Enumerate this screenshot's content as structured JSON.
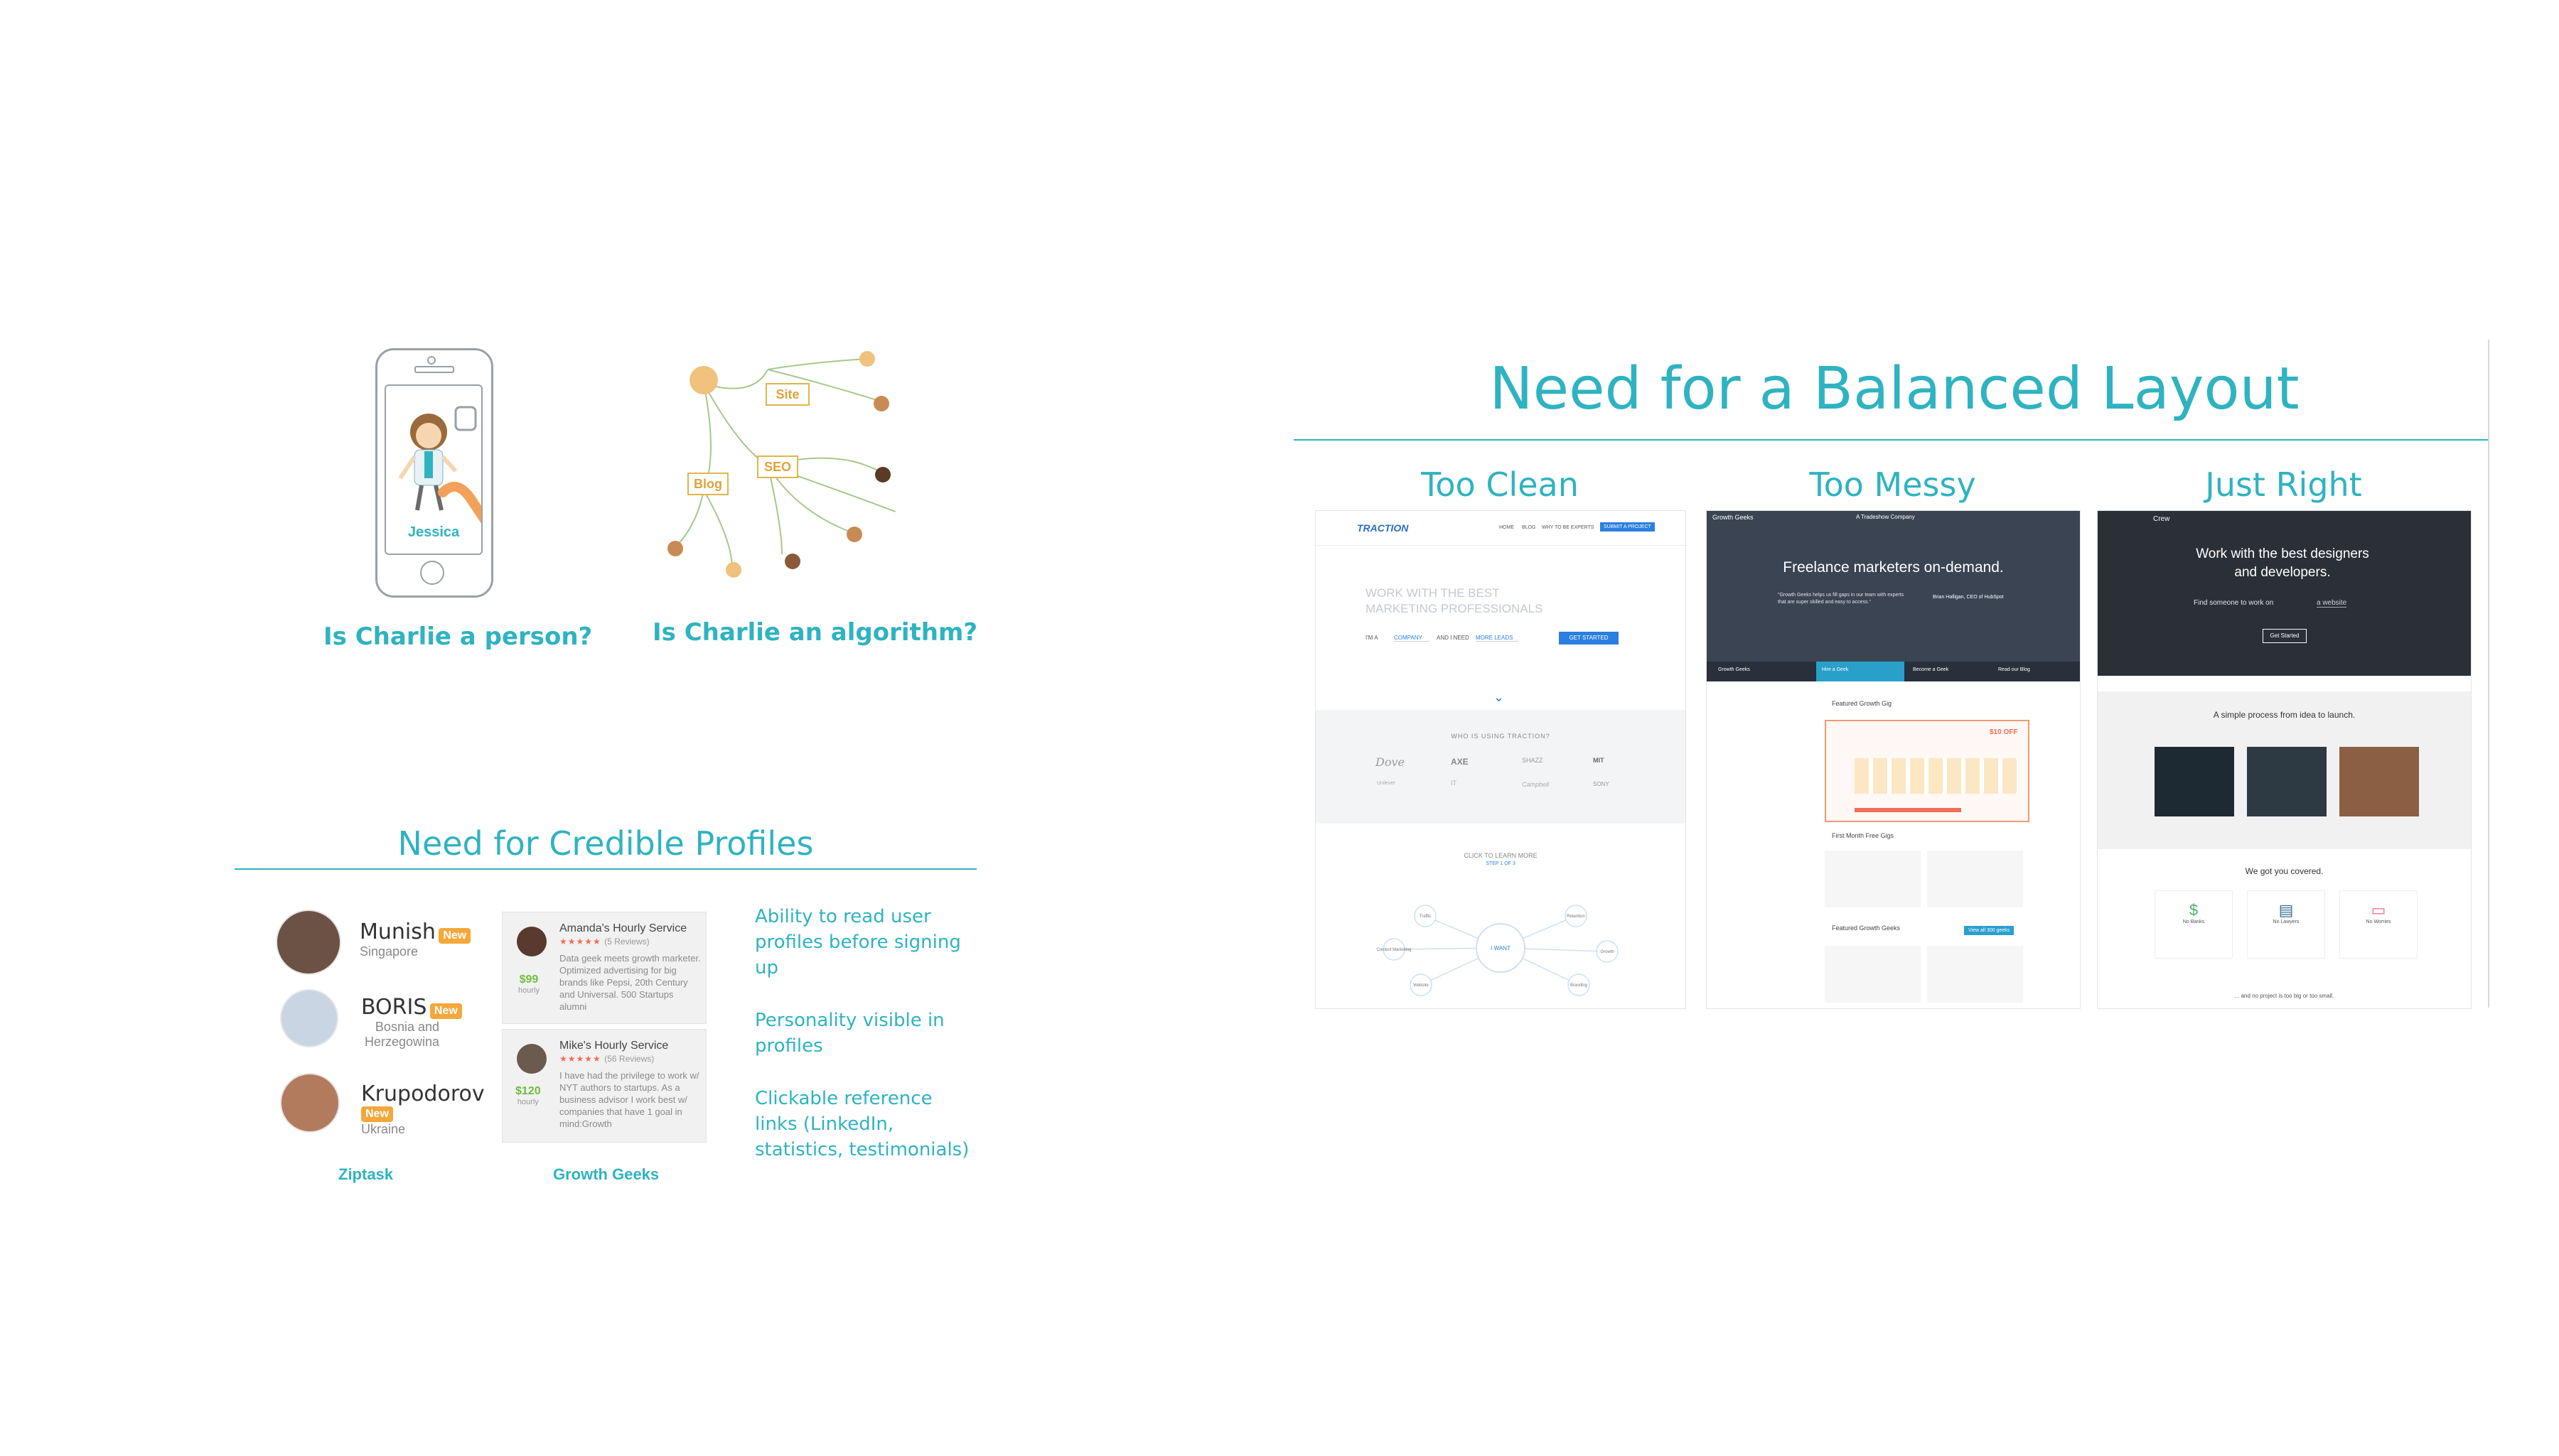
{
  "top_left": {
    "phone": {
      "name": "Jessica"
    },
    "caption_person": "Is Charlie a person?",
    "caption_algorithm": "Is Charlie an algorithm?",
    "network_tags": [
      "Site",
      "SEO",
      "Blog"
    ]
  },
  "profiles": {
    "title": "Need for Credible Profiles",
    "ziptask": {
      "label": "Ziptask",
      "people": [
        {
          "name": "Munish",
          "badge": "New",
          "location": "Singapore"
        },
        {
          "name": "BORIS",
          "badge": "New",
          "location": "Bosnia and Herzegowina"
        },
        {
          "name": "Krupodorov",
          "badge": "New",
          "location": "Ukraine"
        }
      ]
    },
    "growth_geeks": {
      "label": "Growth Geeks",
      "cards": [
        {
          "title": "Amanda's Hourly Service",
          "stars": "★★★★★",
          "reviews": "(5 Reviews)",
          "price": "$99",
          "unit": "hourly",
          "text": "Data geek meets growth marketer. Optimized advertising for big brands like Pepsi, 20th Century and Universal. 500 Startups alumni"
        },
        {
          "title": "Mike's Hourly Service",
          "stars": "★★★★★",
          "reviews": "(56 Reviews)",
          "price": "$120",
          "unit": "hourly",
          "text": "I have had the privilege to work w/ NYT authors to startups. As a business advisor I work best w/ companies that have 1 goal in mind:Growth"
        }
      ]
    },
    "features": [
      "Ability to read user profiles before signing up",
      "Personality visible in profiles",
      "Clickable reference links (LinkedIn, statistics, testimonials)"
    ]
  },
  "layout": {
    "title": "Need for a Balanced Layout",
    "columns": [
      "Too Clean",
      "Too Messy",
      "Just Right"
    ],
    "traction": {
      "logo": "TRACTION",
      "nav": [
        "HOME",
        "BLOG",
        "WHY TO BE EXPERTS"
      ],
      "nav_button": "SUBMIT A PROJECT",
      "hero": "WORK WITH THE BEST MARKETING PROFESSIONALS",
      "form": [
        "I'M A",
        "COMPANY",
        "AND I NEED",
        "MORE LEADS"
      ],
      "cta": "GET STARTED",
      "who": "WHO IS USING TRACTION?",
      "brands": [
        "Dove",
        "AXE",
        "SHAZZ",
        "MIT",
        "Unilever",
        "IT",
        "Campbell",
        "SONY"
      ],
      "learn": "CLICK TO LEARN MORE",
      "learn_sub": "STEP 1 OF 3",
      "hub": "I WANT",
      "nodes": [
        "Traffic",
        "Retention",
        "Growth",
        "Branding",
        "Website",
        "Content Marketing"
      ]
    },
    "growthgeeks": {
      "brand": "Growth Geeks",
      "company": "A Tradeshow Company",
      "hero": "Freelance marketers on-demand.",
      "quote": "\"Growth Geeks helps us fill gaps in our team with experts that are super skilled and easy to access.\"",
      "person": "Brian Halligan, CEO of HubSpot",
      "tabs": [
        "Growth Geeks",
        "Hire a Geek",
        "Become a Geek",
        "Read our Blog"
      ],
      "featured": "Featured Growth Gig",
      "discount": "$10 OFF",
      "first_month": "First Month Free Gigs",
      "featured_geeks": "Featured Growth Geeks",
      "view_all": "View all 300 geeks"
    },
    "crew": {
      "logo": "Crew",
      "hero": "Work with the best designers and developers.",
      "sub": "Find someone to work on",
      "sub_value": "a website",
      "cta": "Get Started",
      "process": "A simple process from idea to launch.",
      "covered": "We got you covered.",
      "features": [
        "No Banks",
        "No Lawyers",
        "No Worries"
      ],
      "footer": "... and no project is too big or too small."
    }
  }
}
